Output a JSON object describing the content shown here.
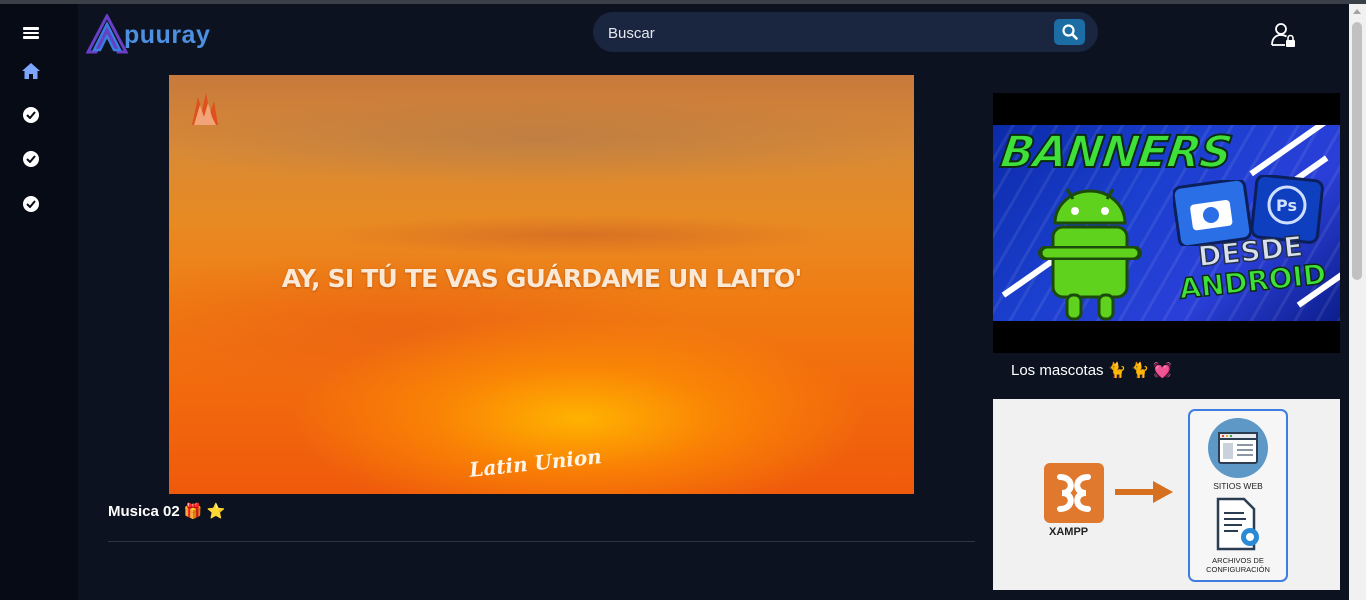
{
  "brand": {
    "name": "puuray"
  },
  "search": {
    "placeholder": "Buscar",
    "value": ""
  },
  "player": {
    "lyric": "AY, SI TÚ TE VAS GUÁRDAME UN LAITO'",
    "watermark": "Latin Union"
  },
  "video": {
    "title": "Musica 02 🎁 ⭐"
  },
  "sidebar_items": [
    {
      "icon": "menu-icon"
    },
    {
      "icon": "home-icon"
    },
    {
      "icon": "check-circle-icon"
    },
    {
      "icon": "check-circle-icon"
    },
    {
      "icon": "check-circle-icon"
    }
  ],
  "related": [
    {
      "thumb_text": {
        "title": "BANNERS",
        "line1": "DESDE",
        "line2": "ANDROID"
      },
      "caption": "Los mascotas 🐈 🐈 💓"
    },
    {
      "thumb_text": {
        "left_label": "XAMPP",
        "box1": "SITIOS WEB",
        "box2": "ARCHIVOS DE CONFIGURACIÓN"
      }
    }
  ],
  "colors": {
    "background": "#0c1220",
    "sidebar": "#070b16",
    "accent": "#1b6da3",
    "brand": "#4d8fe0"
  }
}
